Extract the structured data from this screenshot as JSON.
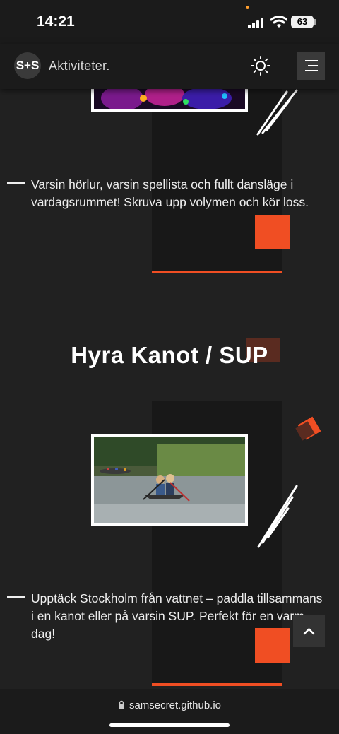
{
  "status_bar": {
    "time": "14:21",
    "battery": "63"
  },
  "header": {
    "logo": "S+S",
    "brand": "Aktiviteter."
  },
  "sections": [
    {
      "description": "Varsin hörlur, varsin spellista och fullt dansläge i vardagsrummet! Skruva upp volymen och kör loss."
    },
    {
      "title": "Hyra Kanot / SUP",
      "description": "Upptäck Stockholm från vattnet – paddla tillsammans i en kanot eller på varsin SUP. Perfekt för en varm dag!"
    }
  ],
  "browser": {
    "url": "samsecret.github.io"
  },
  "colors": {
    "accent": "#f04e23",
    "background": "#212121",
    "panel": "#181818"
  },
  "icons": [
    "sun-icon",
    "menu-icon",
    "chevron-up-icon",
    "lock-icon"
  ]
}
